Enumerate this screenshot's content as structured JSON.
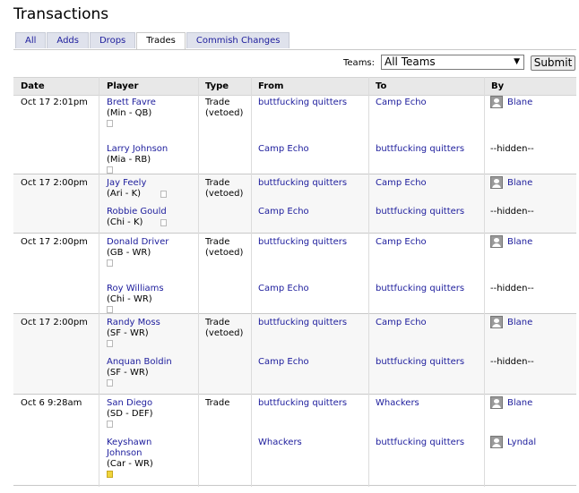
{
  "page": {
    "title": "Transactions"
  },
  "tabs": [
    "All",
    "Adds",
    "Drops",
    "Trades",
    "Commish Changes"
  ],
  "active_tab": "Trades",
  "filter": {
    "label": "Teams:",
    "selected": "All Teams",
    "submit": "Submit"
  },
  "columns": [
    "Date",
    "Player",
    "Type",
    "From",
    "To",
    "By"
  ],
  "groups": [
    {
      "date": "Oct 17 2:01pm",
      "type": [
        "Trade",
        "(vetoed)"
      ],
      "rows": [
        {
          "player": "Brett Favre",
          "team": "(Min - QB)",
          "from": "buttfucking quitters",
          "to": "Camp Echo",
          "by": "Blane",
          "avatar": true,
          "note": "empty"
        },
        {
          "player": "Larry Johnson",
          "team": "(Mia - RB)",
          "from": "Camp Echo",
          "to": "buttfucking quitters",
          "by": "--hidden--",
          "avatar": false,
          "note": "empty"
        }
      ]
    },
    {
      "date": "Oct 17 2:00pm",
      "type": [
        "Trade",
        "(vetoed)"
      ],
      "rows": [
        {
          "player": "Jay Feely",
          "team": "(Ari - K)",
          "from": "buttfucking quitters",
          "to": "Camp Echo",
          "by": "Blane",
          "avatar": true,
          "note": "empty"
        },
        {
          "player": "Robbie Gould",
          "team": "(Chi - K)",
          "from": "Camp Echo",
          "to": "buttfucking quitters",
          "by": "--hidden--",
          "avatar": false,
          "note": "empty"
        }
      ]
    },
    {
      "date": "Oct 17 2:00pm",
      "type": [
        "Trade",
        "(vetoed)"
      ],
      "rows": [
        {
          "player": "Donald Driver",
          "team": "(GB - WR)",
          "from": "buttfucking quitters",
          "to": "Camp Echo",
          "by": "Blane",
          "avatar": true,
          "note": "empty"
        },
        {
          "player": "Roy Williams",
          "team": "(Chi - WR)",
          "from": "Camp Echo",
          "to": "buttfucking quitters",
          "by": "--hidden--",
          "avatar": false,
          "note": "empty"
        }
      ]
    },
    {
      "date": "Oct 17 2:00pm",
      "type": [
        "Trade",
        "(vetoed)"
      ],
      "rows": [
        {
          "player": "Randy Moss",
          "team": "(SF - WR)",
          "from": "buttfucking quitters",
          "to": "Camp Echo",
          "by": "Blane",
          "avatar": true,
          "note": "empty"
        },
        {
          "player": "Anquan Boldin",
          "team": "(SF - WR)",
          "from": "Camp Echo",
          "to": "buttfucking quitters",
          "by": "--hidden--",
          "avatar": false,
          "note": "empty"
        }
      ]
    },
    {
      "date": "Oct 6 9:28am",
      "type": [
        "Trade"
      ],
      "rows": [
        {
          "player": "San Diego",
          "team": "(SD - DEF)",
          "from": "buttfucking quitters",
          "to": "Whackers",
          "by": "Blane",
          "avatar": true,
          "note": "empty"
        },
        {
          "player": "Keyshawn Johnson",
          "team": "(Car - WR)",
          "from": "Whackers",
          "to": "buttfucking quitters",
          "by": "Lyndal",
          "avatar": true,
          "note": "filled"
        }
      ]
    }
  ]
}
